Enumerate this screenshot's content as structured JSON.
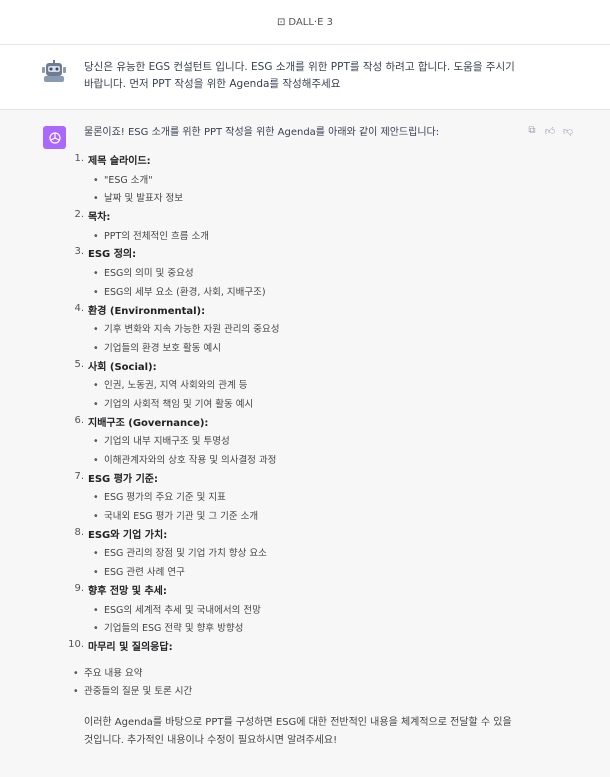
{
  "header": {
    "model_icon": "image-icon",
    "model_name": "DALL·E 3"
  },
  "user": {
    "avatar": "robot-avatar",
    "message": "당신은 유능한 EGS 컨설턴트 입니다. ESG 소개를 위한 PPT를 작성 하려고 합니다. 도움을 주시기 바랍니다. 먼저 PPT 작성을 위한 Agenda를 작성해주세요"
  },
  "assistant": {
    "avatar": "openai-logo",
    "accent_color": "#ab68ff",
    "actions": [
      "copy-icon",
      "thumbs-up-icon",
      "thumbs-down-icon"
    ],
    "intro": "물론이죠! ESG 소개를 위한 PPT 작성을 위한 Agenda를 아래와 같이 제안드립니다:",
    "sections": [
      {
        "num": "1.",
        "title": "제목 슬라이드:",
        "items": [
          "\"ESG 소개\"",
          "날짜 및 발표자 정보"
        ]
      },
      {
        "num": "2.",
        "title": "목차:",
        "items": [
          "PPT의 전체적인 흐름 소개"
        ]
      },
      {
        "num": "3.",
        "title": "ESG 정의:",
        "items": [
          "ESG의 의미 및 중요성",
          "ESG의 세부 요소 (환경, 사회, 지배구조)"
        ]
      },
      {
        "num": "4.",
        "title": "환경 (Environmental):",
        "items": [
          "기후 변화와 지속 가능한 자원 관리의 중요성",
          "기업들의 환경 보호 활동 예시"
        ]
      },
      {
        "num": "5.",
        "title": "사회 (Social):",
        "items": [
          "인권, 노동권, 지역 사회와의 관계 등",
          "기업의 사회적 책임 및 기여 활동 예시"
        ]
      },
      {
        "num": "6.",
        "title": "지배구조 (Governance):",
        "items": [
          "기업의 내부 지배구조 및 투명성",
          "이해관계자와의 상호 작용 및 의사결정 과정"
        ]
      },
      {
        "num": "7.",
        "title": "ESG 평가 기준:",
        "items": [
          "ESG 평가의 주요 기준 및 지표",
          "국내외 ESG 평가 기관 및 그 기준 소개"
        ]
      },
      {
        "num": "8.",
        "title": "ESG와 기업 가치:",
        "items": [
          "ESG 관리의 장점 및 기업 가치 향상 요소",
          "ESG 관련 사례 연구"
        ]
      },
      {
        "num": "9.",
        "title": "향후 전망 및 추세:",
        "items": [
          "ESG의 세계적 추세 및 국내에서의 전망",
          "기업들의 ESG 전략 및 향후 방향성"
        ]
      },
      {
        "num": "10.",
        "title": "마무리 및 질의응답:",
        "items": []
      }
    ],
    "closing_items": [
      "주요 내용 요약",
      "관중들의 질문 및 토론 시간"
    ],
    "outro": "이러한 Agenda를 바탕으로 PPT를 구성하면 ESG에 대한 전반적인 내용을 체계적으로 전달할 수 있을 것입니다. 추가적인 내용이나 수정이 필요하시면 알려주세요!"
  }
}
